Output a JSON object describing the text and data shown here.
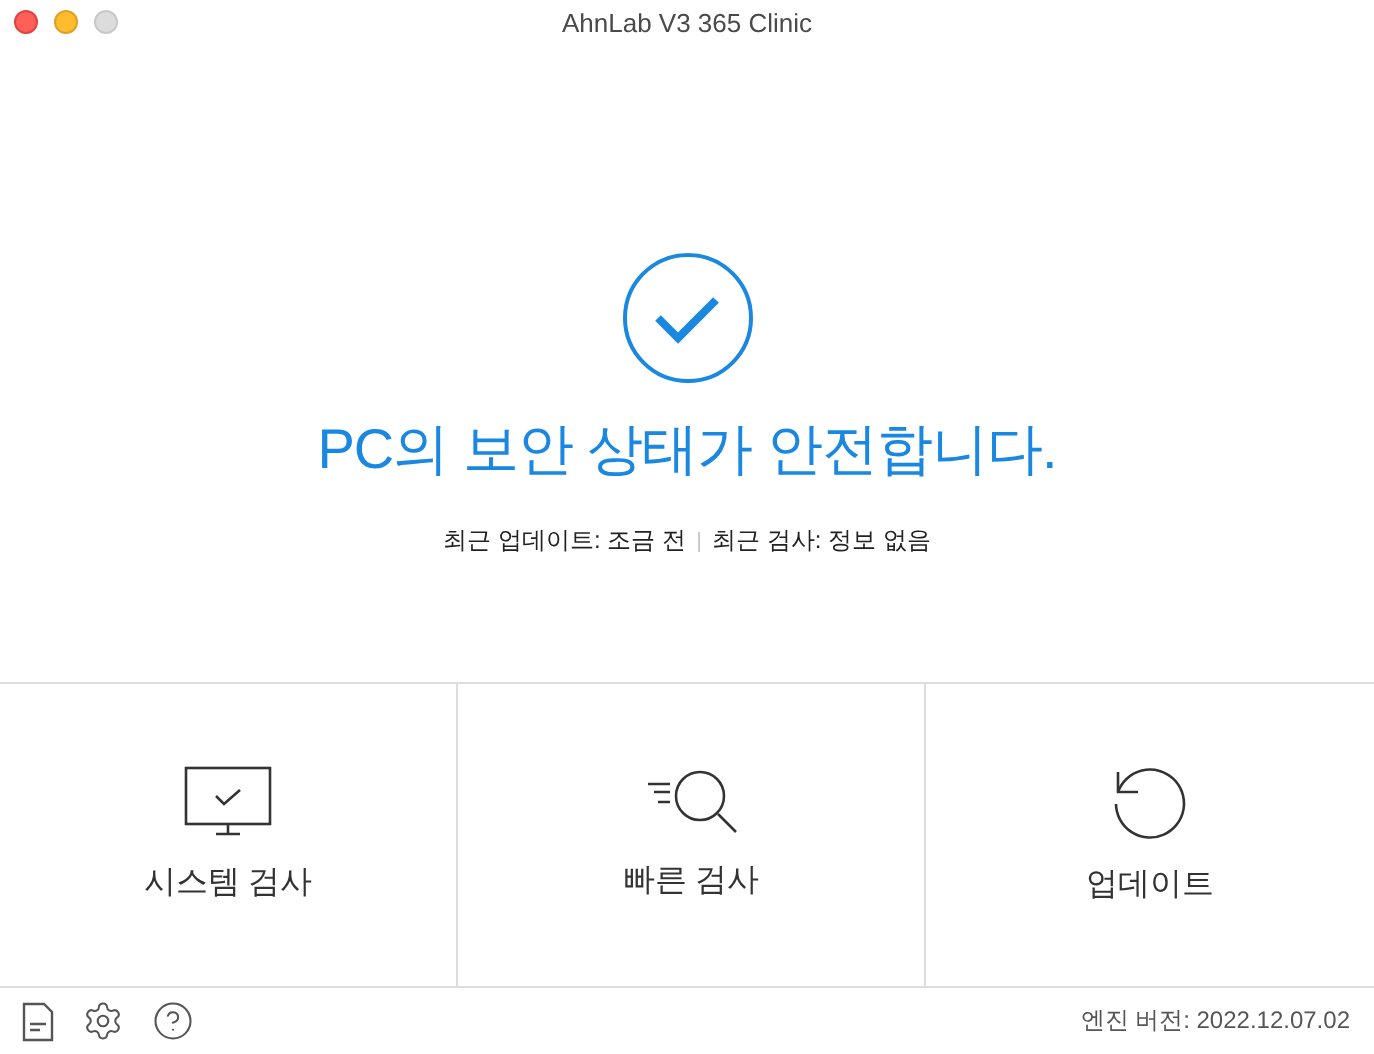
{
  "window": {
    "title": "AhnLab V3 365 Clinic"
  },
  "status": {
    "message": "PC의 보안 상태가 안전합니다.",
    "last_update": "최근 업데이트: 조금 전",
    "last_scan": "최근 검사: 정보 없음"
  },
  "actions": [
    {
      "kind": "system",
      "label": "시스템 검사"
    },
    {
      "kind": "quick",
      "label": "빠른 검사"
    },
    {
      "kind": "update",
      "label": "업데이트"
    }
  ],
  "footer": {
    "engine_version": "엔진 버전: 2022.12.07.02"
  }
}
